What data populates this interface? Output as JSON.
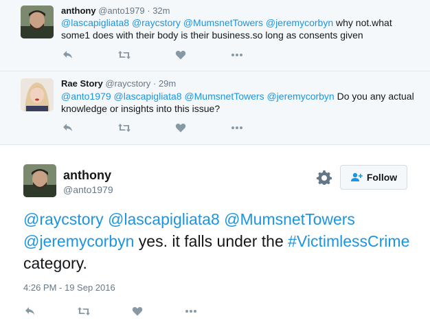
{
  "replies": [
    {
      "name": "anthony",
      "handle": "@anto1979",
      "time": "32m",
      "text": [
        {
          "t": "@lascapigliata8",
          "k": "mention"
        },
        {
          "t": " ",
          "k": "plain"
        },
        {
          "t": "@raycstory",
          "k": "mention"
        },
        {
          "t": " ",
          "k": "plain"
        },
        {
          "t": "@MumsnetTowers",
          "k": "mention"
        },
        {
          "t": " ",
          "k": "plain"
        },
        {
          "t": "@jeremycorbyn",
          "k": "mention"
        },
        {
          "t": " why not.what some1 does with their body is their business.so long as consents given",
          "k": "plain"
        }
      ]
    },
    {
      "name": "Rae Story",
      "handle": "@raycstory",
      "time": "29m",
      "text": [
        {
          "t": "@anto1979",
          "k": "mention"
        },
        {
          "t": " ",
          "k": "plain"
        },
        {
          "t": "@lascapigliata8",
          "k": "mention"
        },
        {
          "t": " ",
          "k": "plain"
        },
        {
          "t": "@MumsnetTowers",
          "k": "mention"
        },
        {
          "t": " ",
          "k": "plain"
        },
        {
          "t": "@jeremycorbyn",
          "k": "mention"
        },
        {
          "t": " Do you any actual knowledge or insights into this issue?",
          "k": "plain"
        }
      ]
    }
  ],
  "main_tweet": {
    "name": "anthony",
    "handle": "@anto1979",
    "follow_label": "Follow",
    "text": [
      {
        "t": "@raycstory",
        "k": "mention"
      },
      {
        "t": " ",
        "k": "plain"
      },
      {
        "t": "@lascapigliata8",
        "k": "mention"
      },
      {
        "t": " ",
        "k": "plain"
      },
      {
        "t": "@MumsnetTowers",
        "k": "mention"
      },
      {
        "t": " ",
        "k": "plain"
      },
      {
        "t": "@jeremycorbyn",
        "k": "mention"
      },
      {
        "t": " yes. it falls under the ",
        "k": "plain"
      },
      {
        "t": "#VictimlessCrime",
        "k": "hashtag"
      },
      {
        "t": " category.",
        "k": "plain"
      }
    ],
    "timestamp": "4:26 PM - 19 Sep 2016"
  },
  "icons": {
    "reply": "reply-icon",
    "retweet": "retweet-icon",
    "like": "heart-icon",
    "more": "more-icon",
    "settings": "gear-icon",
    "follow": "add-user-icon"
  },
  "colors": {
    "link": "#1b95e0",
    "muted": "#657786",
    "action": "#8899a6",
    "reply_bg": "#f5f8fa"
  }
}
